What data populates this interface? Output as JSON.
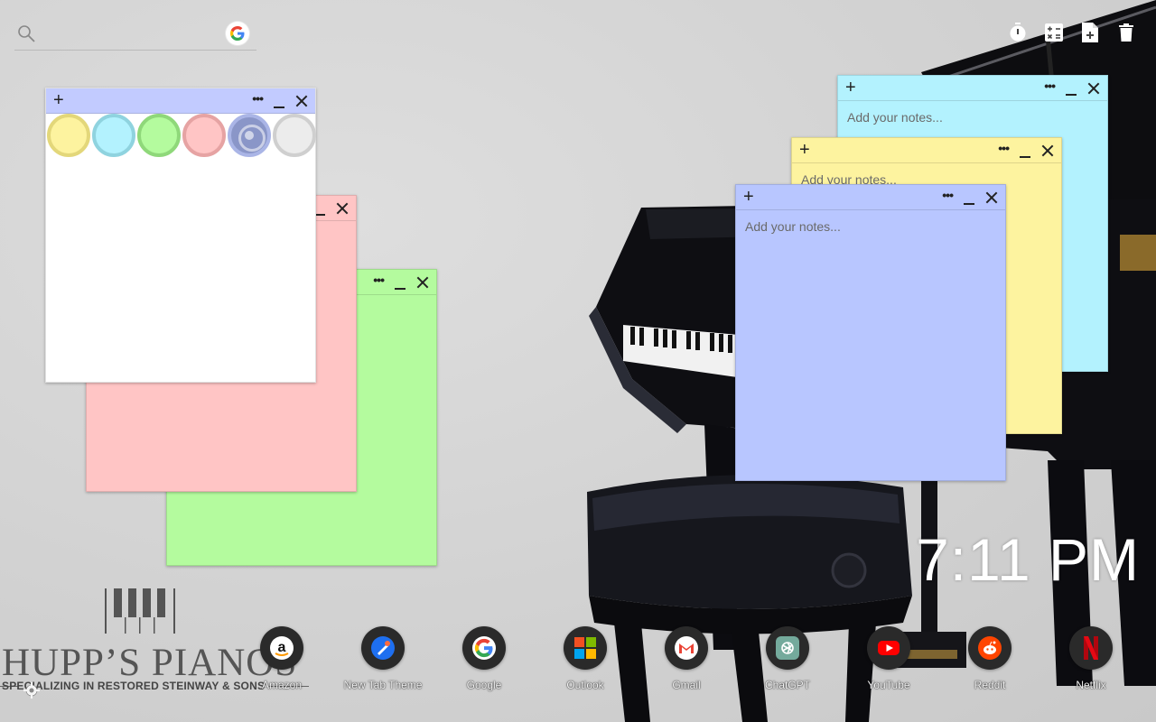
{
  "search": {
    "placeholder": "",
    "value": "",
    "engine_icon": "google-icon"
  },
  "toolbar": {
    "icons": [
      "stopwatch-icon",
      "calculator-icon",
      "new-note-icon",
      "trash-icon"
    ]
  },
  "notes": {
    "white": {
      "header_color": "#c2cbff",
      "body_color": "#ffffff",
      "add_label": "+",
      "more_label": "•••"
    },
    "pink": {
      "color": "#ffc5c5"
    },
    "green": {
      "color": "#b4fb9e",
      "more_label": "•••"
    },
    "cyan": {
      "color": "#b3f2fe",
      "add_label": "+",
      "more_label": "•••",
      "placeholder": "Add your notes..."
    },
    "yellow": {
      "color": "#fdf39f",
      "add_label": "+",
      "more_label": "•••",
      "placeholder": "Add your notes..."
    },
    "blue": {
      "color": "#b8c6ff",
      "add_label": "+",
      "more_label": "•••",
      "placeholder": "Add your notes..."
    }
  },
  "swatches": [
    {
      "name": "yellow",
      "fill": "#fdf39f",
      "ring": "#e3d77a"
    },
    {
      "name": "cyan",
      "fill": "#b3f2fe",
      "ring": "#8fd3df"
    },
    {
      "name": "green",
      "fill": "#b4fb9e",
      "ring": "#8fd87a"
    },
    {
      "name": "pink",
      "fill": "#ffc5c5",
      "ring": "#e6a3a3"
    },
    {
      "name": "periwinkle",
      "fill": "#8a96c8",
      "ring": "#aab5e6",
      "selected": true
    },
    {
      "name": "white",
      "fill": "#ececec",
      "ring": "#cfcfcf"
    }
  ],
  "clock": {
    "time": "7:11 PM"
  },
  "logo": {
    "name": "HUPP’S PIANOS",
    "tagline": "SPECIALIZING IN RESTORED STEINWAY & SONS"
  },
  "shortcuts": [
    {
      "label": "Amazon",
      "icon": "amazon-icon"
    },
    {
      "label": "New Tab Theme",
      "icon": "new-tab-theme-icon"
    },
    {
      "label": "Google",
      "icon": "google-icon"
    },
    {
      "label": "Outlook",
      "icon": "outlook-icon"
    },
    {
      "label": "Gmail",
      "icon": "gmail-icon"
    },
    {
      "label": "ChatGPT",
      "icon": "chatgpt-icon"
    },
    {
      "label": "YouTube",
      "icon": "youtube-icon"
    },
    {
      "label": "Reddit",
      "icon": "reddit-icon"
    },
    {
      "label": "Netflix",
      "icon": "netflix-icon"
    }
  ],
  "colors": {
    "background": "#d2d2d2",
    "shortcut_circle": "#2a2a2a",
    "clock_text": "#ffffff"
  }
}
